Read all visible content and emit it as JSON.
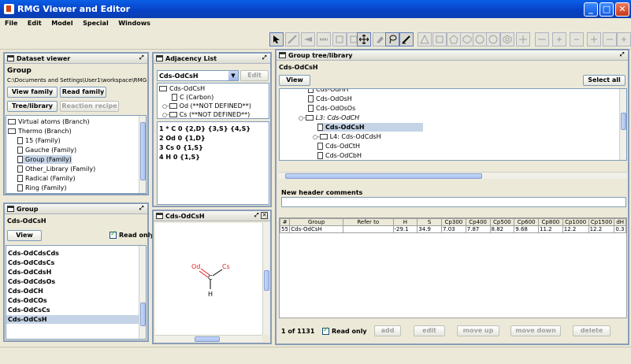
{
  "window": {
    "title": "RMG Viewer and Editor",
    "minimize": "_",
    "maximize": "□",
    "close": "✕"
  },
  "menu": [
    "File",
    "Edit",
    "Model",
    "Special",
    "Windows"
  ],
  "dataset": {
    "title": "Dataset viewer",
    "label": "Group",
    "path": "C:\\Documents and Settings\\User1\\workspace\\RMG-3.0\\d...",
    "btn_view_family": "View family",
    "btn_read_family": "Read family",
    "btn_tree": "Tree/library",
    "btn_reaction": "Reaction recipe",
    "items": [
      "Virtual atoms (Branch)",
      "Thermo (Branch)",
      "15 (Family)",
      "Gauche (Family)",
      "Group (Family)",
      "Other_Library (Family)",
      "Radical (Family)",
      "Ring (Family)"
    ]
  },
  "adjacency": {
    "title": "Adjacency List",
    "selected": "Cds-OdCsH",
    "edit": "Edit",
    "tree": [
      "Cds-OdCsH",
      "C (Carbon)",
      "Od (**NOT DEFINED**)",
      "Cs (**NOT DEFINED**)"
    ],
    "lines": [
      "1 * C 0 {2,D} {3,S} {4,S}",
      "2 Od 0 {1,D}",
      "3 Cs 0 {1,S}",
      "4 H 0 {1,S}"
    ]
  },
  "group": {
    "title": "Group",
    "label": "Cds-OdCsH",
    "view": "View",
    "readonly": "Read only",
    "items": [
      "Cds-OdCdsCds",
      "Cds-OdCdsCs",
      "Cds-OdCdsH",
      "Cds-OdCdsOs",
      "Cds-OdCH",
      "Cds-OdCOs",
      "Cds-OdCsCs",
      "Cds-OdCsH"
    ]
  },
  "structure": {
    "title": "Cds-OdCsH",
    "atoms": {
      "od": "Od",
      "c": "C",
      "cs": "Cs",
      "h": "H"
    }
  },
  "library": {
    "title": "Group tree/library",
    "label": "Cds-OdCsH",
    "view": "View",
    "select_all": "Select all",
    "tree": [
      "Cds-OdOsH",
      "Cds-OdOsOs",
      "L3: Cds-OdCH",
      "Cds-OdCsH",
      "L4: Cds-OdCdsH",
      "Cds-OdCtH",
      "Cds-OdCbH"
    ],
    "comments_label": "New header comments",
    "columns": [
      "#",
      "Group",
      "Refer to",
      "H",
      "S",
      "Cp300",
      "Cp400",
      "Cp500",
      "Cp600",
      "Cp800",
      "Cp1000",
      "Cp1500",
      "dH"
    ],
    "rows": [
      [
        "55",
        "Cds-OdCsH",
        "",
        "-29.1",
        "34.9",
        "7.03",
        "7.87",
        "8.82",
        "9.68",
        "11.2",
        "12.2",
        "12.2",
        "0.3"
      ]
    ],
    "count": "1 of 1131",
    "readonly": "Read only",
    "add": "add",
    "edit": "edit",
    "move_up": "move up",
    "move_down": "move down",
    "delete": "delete"
  },
  "colors": {
    "accent": "#0a5fe6",
    "selection": "#c5d3e6",
    "atom_red": "#e02020"
  }
}
